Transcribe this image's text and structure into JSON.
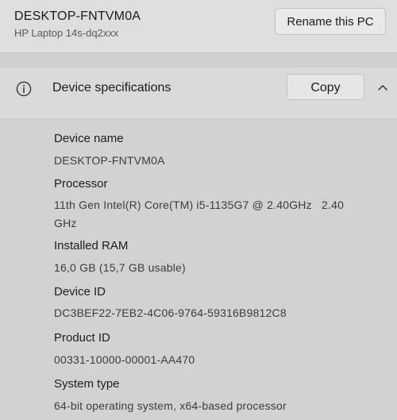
{
  "device": {
    "pc_name": "DESKTOP-FNTVM0A",
    "model": "HP Laptop 14s-dq2xxx",
    "rename_label": "Rename this PC"
  },
  "specs": {
    "section_title": "Device specifications",
    "copy_label": "Copy",
    "icons": {
      "info": "info-circle-icon",
      "collapse": "chevron-up-icon"
    },
    "items": [
      {
        "label": "Device name",
        "value_lines": [
          "DESKTOP-FNTVM0A"
        ]
      },
      {
        "label": "Processor",
        "value_lines": [
          "11th Gen Intel(R) Core(TM) i5-1135G7 @ 2.40GHz   2.40",
          "GHz"
        ]
      },
      {
        "label": "Installed RAM",
        "value_lines": [
          "16,0 GB (15,7 GB usable)"
        ]
      },
      {
        "label": "Device ID",
        "value_lines": [
          "DC3BEF22-7EB2-4C06-9764-59316B9812C8"
        ]
      },
      {
        "label": "Product ID",
        "value_lines": [
          "00331-10000-00001-AA470"
        ]
      },
      {
        "label": "System type",
        "value_lines": [
          "64-bit operating system, x64-based processor"
        ]
      }
    ]
  }
}
